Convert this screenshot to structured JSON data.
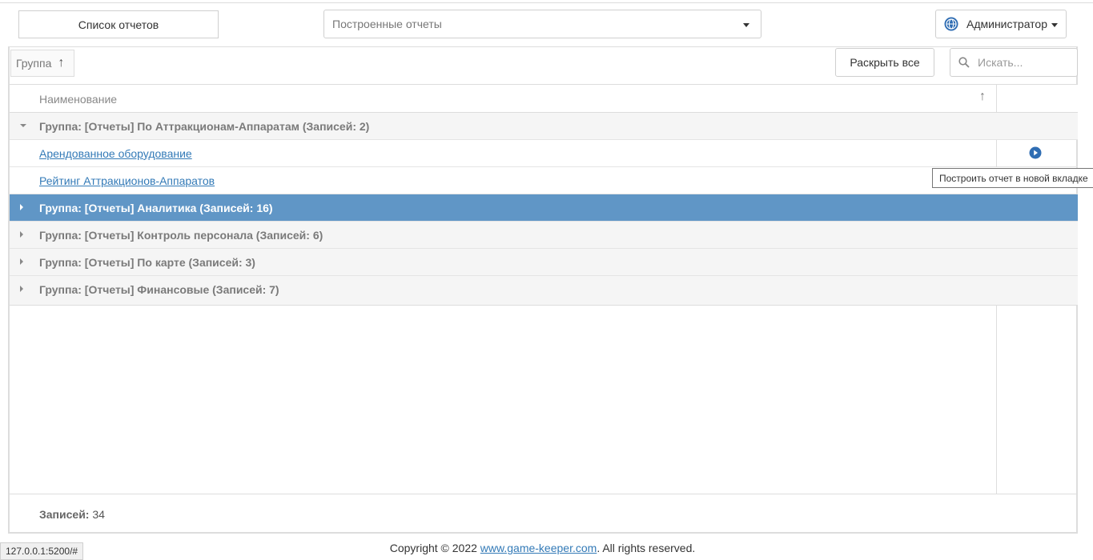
{
  "header": {
    "reports_list_label": "Список отчетов",
    "built_reports_placeholder": "Построенные отчеты",
    "user_label": "Администратор"
  },
  "toolbar": {
    "group_chip_label": "Группа",
    "expand_all_label": "Раскрыть все",
    "search_placeholder": "Искать..."
  },
  "table": {
    "column_name": "Наименование",
    "groups": [
      {
        "label": "Группа: [Отчеты] По Аттракционам-Аппаратам (Записей: 2)",
        "expanded": true,
        "items": [
          "Арендованное оборудование",
          "Рейтинг Аттракционов-Аппаратов"
        ]
      },
      {
        "label": "Группа: [Отчеты] Аналитика (Записей: 16)",
        "expanded": false,
        "selected": true
      },
      {
        "label": "Группа: [Отчеты] Контроль персонала (Записей: 6)",
        "expanded": false
      },
      {
        "label": "Группа: [Отчеты] По карте (Записей: 3)",
        "expanded": false
      },
      {
        "label": "Группа: [Отчеты] Финансовые (Записей: 7)",
        "expanded": false
      }
    ],
    "tooltip": "Построить отчет в новой вкладке",
    "records_label": "Записей:",
    "records_count": "34"
  },
  "footer": {
    "copyright_prefix": "Copyright © 2022 ",
    "site_link": "www.game-keeper.com",
    "copyright_suffix": ". All rights reserved."
  },
  "statusbar": {
    "url": "127.0.0.1:5200/#"
  },
  "colors": {
    "selected_row": "#6096c6",
    "link": "#337ab7",
    "accent_icon": "#2f6db3"
  },
  "icons": {
    "user": "globe-icon",
    "search": "search-icon",
    "run": "play-circle-icon",
    "sort": "arrow-up-icon"
  }
}
